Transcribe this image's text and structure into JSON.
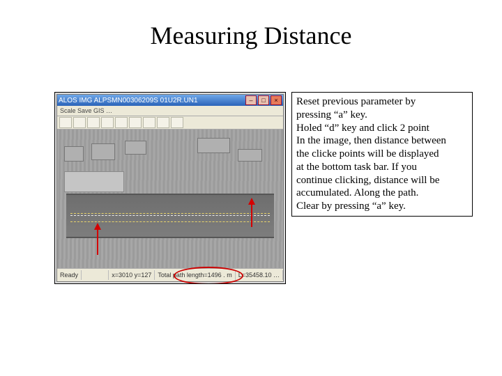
{
  "title": "Measuring Distance",
  "instructions": {
    "l1": "Reset previous parameter by",
    "l2": " pressing “a” key.",
    "l3": "Holed “d” key and click 2 point",
    "l4": "In the image, then distance between",
    "l5": " the clicke points will be displayed",
    "l6": " at the bottom task bar. If you",
    "l7": " continue clicking, distance will be",
    "l8": " accumulated. Along the path.",
    "l9": "Clear by pressing “a” key."
  },
  "window": {
    "title": "ALOS    IMG  ALPSMN00306209S  01U2R.UN1",
    "min_glyph": "–",
    "max_glyph": "□",
    "close_glyph": "×",
    "menu_text": "Scale   Save   GIS  …"
  },
  "status": {
    "ready": "Ready",
    "coords": "x=3010  y=127",
    "pathlen": "Total path length=1496 . m",
    "latlon": "L=35458.10  …"
  }
}
